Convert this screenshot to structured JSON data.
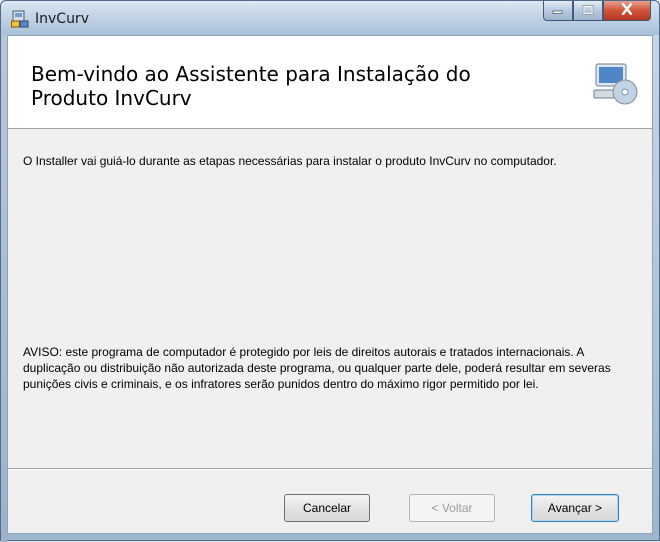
{
  "window": {
    "title": "InvCurv",
    "controls": {
      "minimize_icon": "minimize-icon",
      "maximize_icon": "maximize-icon",
      "close_icon": "close-icon"
    }
  },
  "banner": {
    "title": "Bem-vindo ao Assistente para Instalação do Produto InvCurv",
    "icon": "computer-disc-icon"
  },
  "body": {
    "intro": "O Installer vai guiá-lo durante as etapas necessárias para instalar o produto InvCurv no computador.",
    "warning": "AVISO: este programa de computador é protegido por leis de direitos autorais e tratados internacionais. A duplicação ou distribuição não autorizada deste programa, ou qualquer parte dele, poderá resultar em severas punições civis e criminais, e os infratores serão punidos dentro do máximo rigor permitido por lei."
  },
  "buttons": {
    "cancel": "Cancelar",
    "back": "< Voltar",
    "next": "Avançar >"
  },
  "colors": {
    "close_button": "#c9432b",
    "banner_background": "#ffffff",
    "dialog_background": "#f0f0f0"
  }
}
